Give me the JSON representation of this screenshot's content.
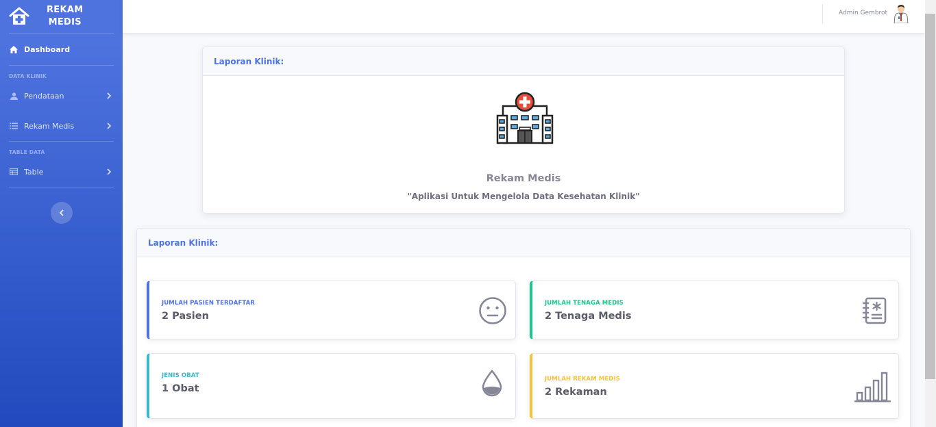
{
  "brand": {
    "line1": "REKAM",
    "line2": "MEDIS"
  },
  "sidebar": {
    "dashboard": "Dashboard",
    "heading_data": "DATA KLINIK",
    "pendataan": "Pendataan",
    "rekam_medis": "Rekam Medis",
    "heading_table": "TABLE DATA",
    "table": "Table"
  },
  "topbar": {
    "user_name": "Admin Gembrot"
  },
  "card1": {
    "header": "Laporan Klinik:",
    "title": "Rekam Medis",
    "subtitle": "\"Aplikasi Untuk Mengelola Data Kesehatan Klinik\""
  },
  "card2": {
    "header": "Laporan Klinik:"
  },
  "stats": [
    {
      "label": "JUMLAH PASIEN TERDAFTAR",
      "value": "2 Pasien",
      "icon": "neutral-face-icon",
      "color": "#4e73df"
    },
    {
      "label": "JUMLAH TENAGA MEDIS",
      "value": "2 Tenaga Medis",
      "icon": "medical-notebook-icon",
      "color": "#1cc88a"
    },
    {
      "label": "JENIS OBAT",
      "value": "1 Obat",
      "icon": "drop-icon",
      "color": "#36b9cc"
    },
    {
      "label": "JUMLAH REKAM MEDIS",
      "value": "2 Rekaman",
      "icon": "bar-chart-icon",
      "color": "#f6c23e"
    }
  ],
  "colors": {
    "primary": "#4e73df",
    "success": "#1cc88a",
    "info": "#36b9cc",
    "warning": "#f6c23e"
  }
}
